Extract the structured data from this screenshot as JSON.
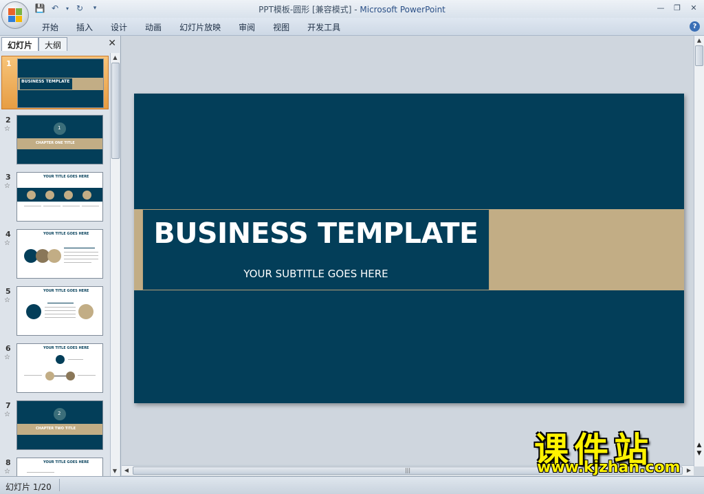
{
  "window": {
    "title_prefix": "PPT模板-圆形 [兼容模式]",
    "title_sep": " - ",
    "app_name": "Microsoft PowerPoint"
  },
  "ribbon": {
    "tabs": [
      "开始",
      "插入",
      "设计",
      "动画",
      "幻灯片放映",
      "审阅",
      "视图",
      "开发工具"
    ]
  },
  "left_pane": {
    "tabs": [
      "幻灯片",
      "大纲"
    ],
    "active_tab": "幻灯片",
    "thumbnails": [
      {
        "num": "1",
        "title": "BUSINESS TEMPLATE",
        "selected": true
      },
      {
        "num": "2",
        "title": "CHAPTER ONE TITLE",
        "badge": "1"
      },
      {
        "num": "3",
        "title": "YOUR TITLE GOES HERE"
      },
      {
        "num": "4",
        "title": "YOUR TITLE GOES HERE"
      },
      {
        "num": "5",
        "title": "YOUR TITLE GOES HERE"
      },
      {
        "num": "6",
        "title": "YOUR TITLE GOES HERE"
      },
      {
        "num": "7",
        "title": "CHAPTER TWO TITLE",
        "badge": "2"
      },
      {
        "num": "8",
        "title": "YOUR TITLE GOES HERE"
      }
    ]
  },
  "slide": {
    "title": "BUSINESS TEMPLATE",
    "subtitle": "YOUR SUBTITLE GOES HERE",
    "colors": {
      "background": "#033e59",
      "accent": "#c2ad85",
      "text": "#ffffff"
    }
  },
  "status_bar": {
    "slide_indicator": "幻灯片 1/20"
  },
  "watermark": {
    "brand": "课件站",
    "url": "www.kjzhan.com"
  }
}
